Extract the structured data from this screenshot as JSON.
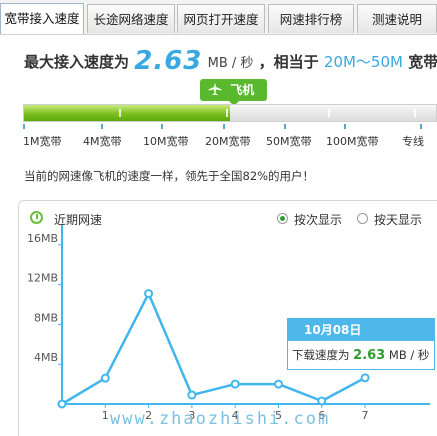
{
  "tabs": [
    {
      "label": "宽带接入速度",
      "active": true
    },
    {
      "label": "长途网络速度",
      "active": false
    },
    {
      "label": "网页打开速度",
      "active": false
    },
    {
      "label": "网速排行榜",
      "active": false
    },
    {
      "label": "测速说明",
      "active": false
    }
  ],
  "headline": {
    "prefix": "最大接入速度为",
    "speed": "2.63",
    "unit": "MB / 秒",
    "middle": "，相当于",
    "range": "20M～50M",
    "suffix": "宽带"
  },
  "speed_bar": {
    "badge_label": "飞机",
    "badge_icon": "airplane-icon",
    "fill_fraction": 0.5,
    "scale_labels": [
      "1M宽带",
      "4M宽带",
      "10M宽带",
      "20M宽带",
      "50M宽带",
      "100M宽带",
      "专线"
    ],
    "fill_color": "#7cc01e"
  },
  "notice": "当前的网速像飞机的速度一样，领先于全国82%的用户！",
  "chart_panel": {
    "title": "近期网速",
    "title_icon": "clock-icon",
    "options": [
      {
        "label": "按次显示",
        "selected": true
      },
      {
        "label": "按天显示",
        "selected": false
      }
    ]
  },
  "chart_data": {
    "type": "line",
    "x": [
      0,
      1,
      2,
      3,
      4,
      5,
      6,
      7
    ],
    "y": [
      0,
      2.6,
      11.1,
      0.9,
      2.0,
      2.0,
      0.3,
      2.63
    ],
    "x_tick_labels": [
      "1",
      "2",
      "3",
      "4",
      "5",
      "6",
      "7"
    ],
    "y_ticks": [
      "4MB",
      "8MB",
      "12MB",
      "16MB"
    ],
    "y_tick_values": [
      4,
      8,
      12,
      16
    ],
    "ylim": [
      0,
      18
    ],
    "xlim": [
      0,
      8.5
    ],
    "line_color": "#41b6ee",
    "grid": false
  },
  "tooltip": {
    "date": "10月08日",
    "label": "下载速度为",
    "value": "2.63",
    "unit": "MB / 秒"
  },
  "watermark": "www.zhaozhishi.com"
}
